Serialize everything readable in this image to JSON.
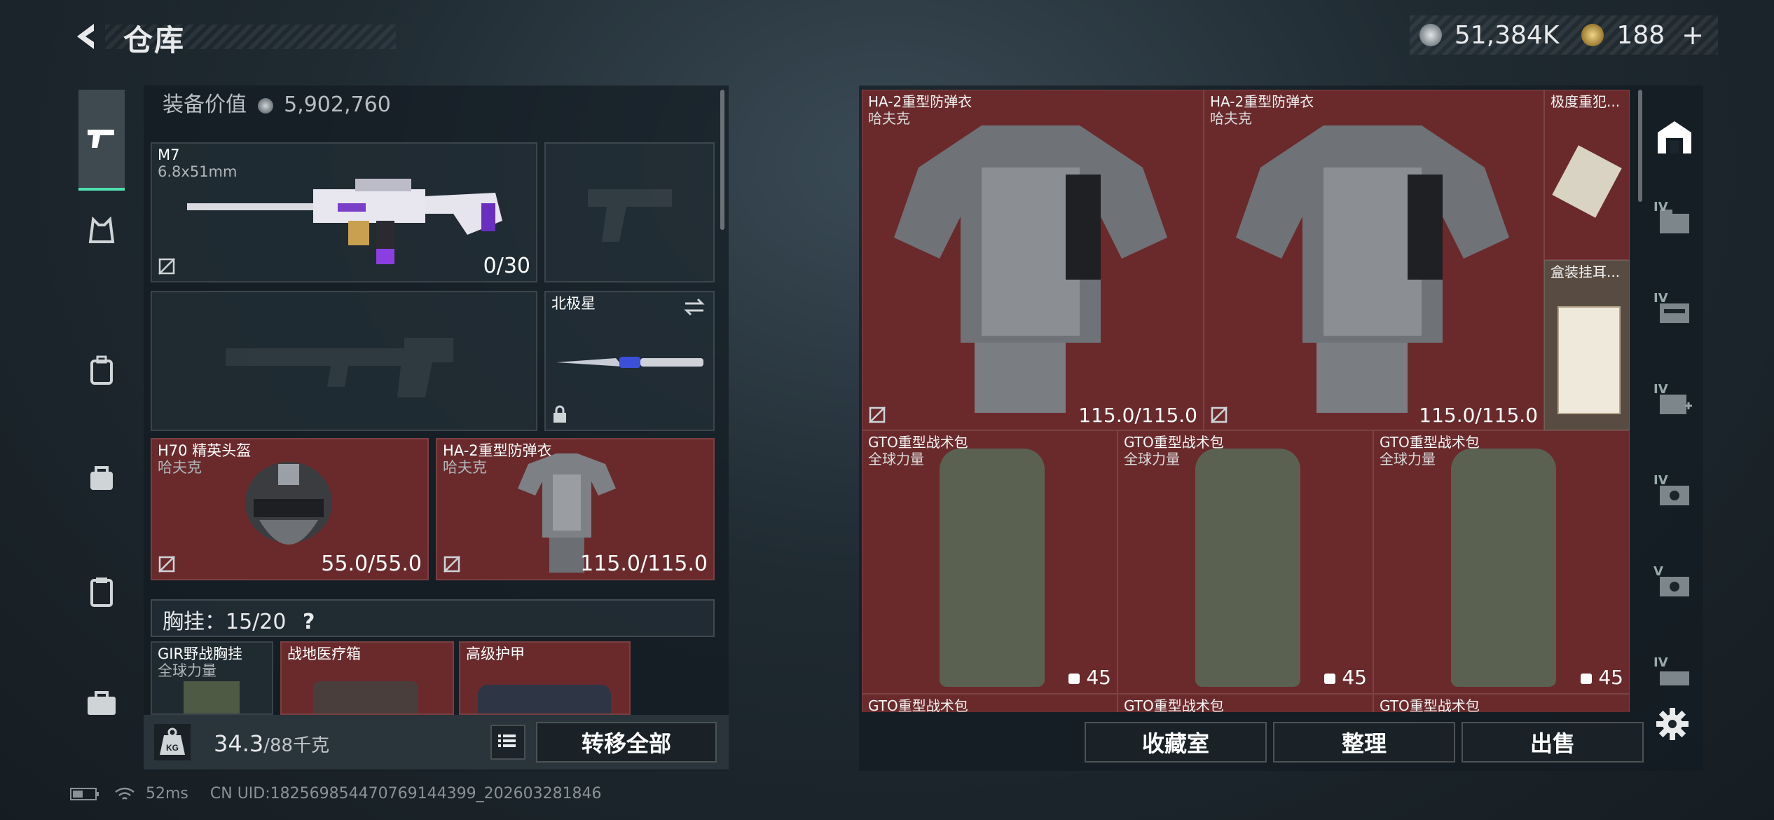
{
  "header": {
    "title": "仓库",
    "currency": [
      {
        "icon": "silver-coin-icon",
        "value": "51,384K",
        "color": "#b9c2c8"
      },
      {
        "icon": "gold-coin-icon",
        "value": "188",
        "color": "#d8b45a"
      }
    ],
    "plus": "+"
  },
  "left_panel": {
    "equip_value_label": "装备价值",
    "equip_value": "5,902,760",
    "weapon_primary": {
      "name": "M7",
      "caliber": "6.8x51mm",
      "ammo": "0/30"
    },
    "melee": {
      "name": "北极星"
    },
    "helmet": {
      "name": "H70 精英头盔",
      "brand": "哈夫克",
      "durability": "55.0/55.0"
    },
    "armor": {
      "name": "HA-2重型防弹衣",
      "brand": "哈夫克",
      "durability": "115.0/115.0"
    },
    "chest_rig": {
      "label": "胸挂：15/20",
      "help": "?"
    },
    "rig_items": [
      {
        "name": "GIR野战胸挂",
        "sub": "全球力量"
      },
      {
        "name": "战地医疗箱",
        "sub": ""
      },
      {
        "name": "高级护甲",
        "sub": ""
      }
    ],
    "weight": {
      "value": "34.3",
      "max": "/88千克"
    },
    "transfer_all": "转移全部"
  },
  "warehouse": {
    "items_row1": [
      {
        "name": "HA-2重型防弹衣",
        "brand": "哈夫克",
        "durability": "115.0/115.0"
      },
      {
        "name": "HA-2重型防弹衣",
        "brand": "哈夫克",
        "durability": "115.0/115.0"
      }
    ],
    "small_items": [
      {
        "name": "极度重犯..."
      },
      {
        "name": "盒装挂耳..."
      }
    ],
    "bags": [
      {
        "name": "GTO重型战术包",
        "brand": "全球力量",
        "capacity": "45"
      },
      {
        "name": "GTO重型战术包",
        "brand": "全球力量",
        "capacity": "45"
      },
      {
        "name": "GTO重型战术包",
        "brand": "全球力量",
        "capacity": "45"
      }
    ],
    "bags_row2": [
      {
        "name": "GTO重型战术包"
      },
      {
        "name": "GTO重型战术包"
      },
      {
        "name": "GTO重型战术包"
      }
    ],
    "buttons": {
      "collection": "收藏室",
      "organize": "整理",
      "sell": "出售"
    }
  },
  "right_sidebar": {
    "tabs": [
      {
        "icon": "storage-home-icon"
      },
      {
        "label": "IV",
        "icon": "folder-icon"
      },
      {
        "label": "IV",
        "icon": "gun-case-icon"
      },
      {
        "label": "IV",
        "icon": "medical-case-icon"
      },
      {
        "label": "IV",
        "icon": "cash-case-icon"
      },
      {
        "label": "V",
        "icon": "cash-case-icon"
      },
      {
        "label": "IV",
        "icon": "case-icon"
      }
    ]
  },
  "status_bar": {
    "ping": "52ms",
    "uid": "CN UID:1825698544707691443​99_202603281846"
  }
}
